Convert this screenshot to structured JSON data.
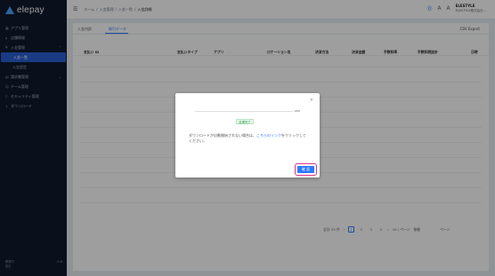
{
  "brand": {
    "name": "elepay"
  },
  "sidebar": {
    "items": [
      {
        "label": "アプリ管理",
        "icon": "grid-icon"
      },
      {
        "label": "店舗情報",
        "icon": "store-icon"
      },
      {
        "label": "入金管理",
        "icon": "yen-icon",
        "expanded": true
      },
      {
        "label": "請求書管理",
        "icon": "invoice-icon",
        "expanded": false
      },
      {
        "label": "チーム管理",
        "icon": "team-icon"
      },
      {
        "label": "セキュリティ管理",
        "icon": "shield-icon"
      },
      {
        "label": "ダウンロード",
        "icon": "download-icon"
      }
    ],
    "sub_items": [
      {
        "label": "入金一覧",
        "active": true
      },
      {
        "label": "入金設定",
        "active": false
      }
    ],
    "footer": {
      "line1": "開発中",
      "line2": "設定",
      "code": "0 0"
    }
  },
  "header": {
    "breadcrumb": [
      "ホーム",
      "/",
      "入金管理",
      "/",
      "入金一覧",
      "/",
      "入金詳細"
    ],
    "user": {
      "name": "ELESTYLE",
      "email": "ELESTYLE株式会社..."
    }
  },
  "tabs": [
    {
      "label": "入金内訳",
      "active": false
    },
    {
      "label": "取引データ",
      "active": true
    }
  ],
  "csv_button": "CSV Export",
  "table": {
    "columns": [
      "支払い ID",
      "支払いタイプ",
      "アプリ",
      "ロケーション名",
      "決済方法",
      "決済金額",
      "手数料率",
      "手数料税抜計",
      "日時"
    ]
  },
  "pagination": {
    "total": "全計 33 件",
    "pages": [
      "1",
      "2",
      "3",
      "4"
    ],
    "current": "1",
    "per_page": "10 / ページ",
    "goto": "移動",
    "page_suffix": "ページ"
  },
  "modal": {
    "url_suffix": ".csv",
    "status_badge": "処理完了",
    "message_before": "ダウンロードが自動開始されない場合は、",
    "message_link": "こちらのリンク",
    "message_after": "をクリックしてください。",
    "confirm_label": "確 認"
  }
}
